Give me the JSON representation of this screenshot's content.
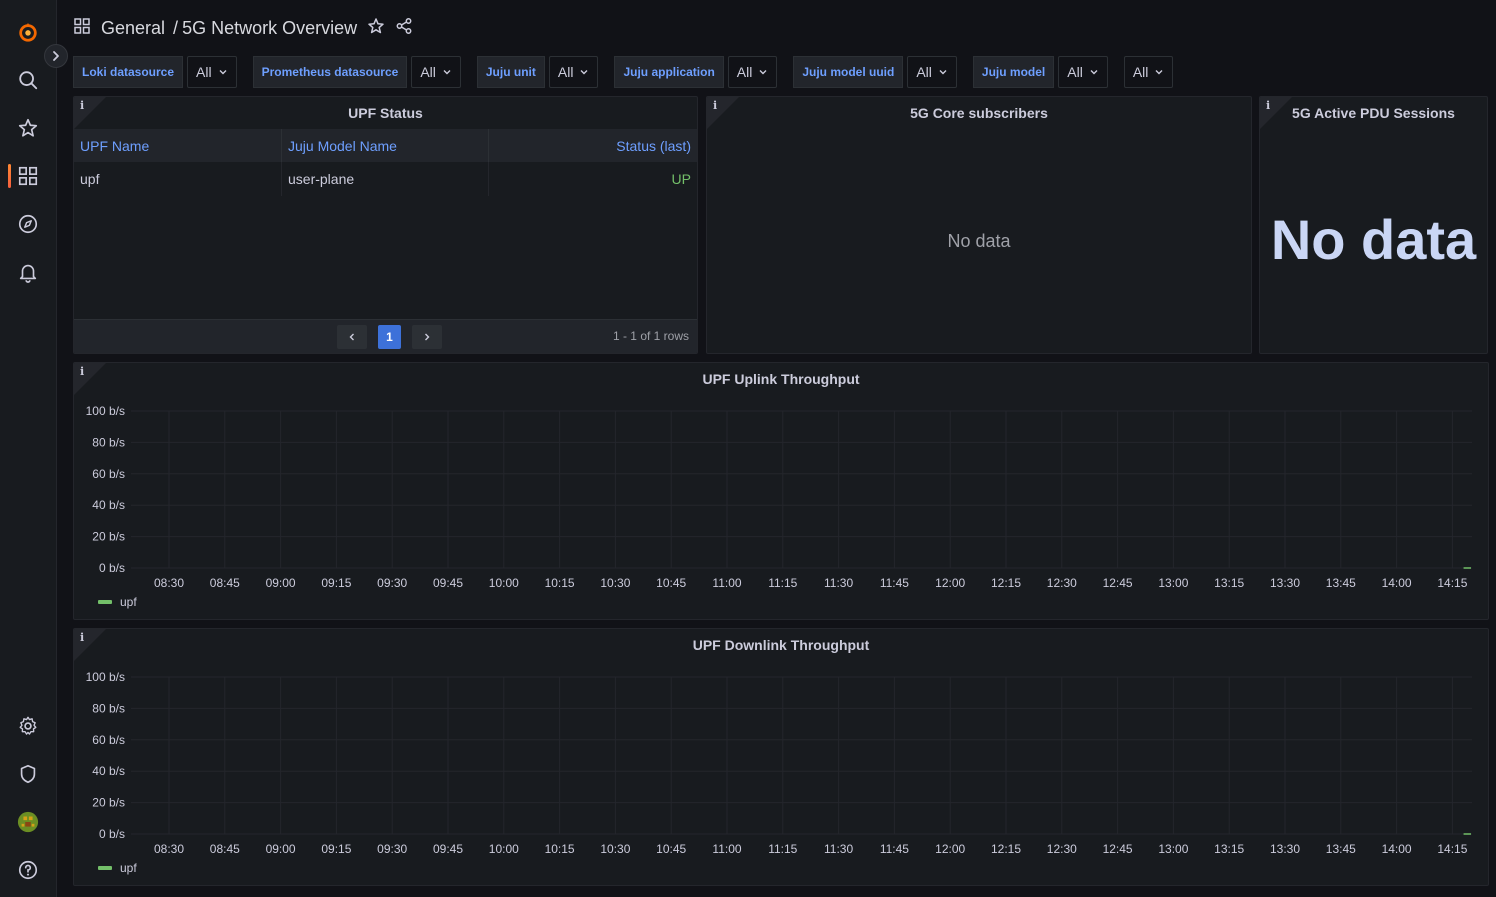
{
  "header": {
    "folder": "General",
    "separator": "/",
    "title": "5G Network Overview"
  },
  "variables": [
    {
      "label": "Loki datasource",
      "value": "All"
    },
    {
      "label": "Prometheus datasource",
      "value": "All"
    },
    {
      "label": "Juju unit",
      "value": "All"
    },
    {
      "label": "Juju application",
      "value": "All"
    },
    {
      "label": "Juju model uuid",
      "value": "All"
    },
    {
      "label": "Juju model",
      "value": "All"
    },
    {
      "label": "",
      "value": "All"
    }
  ],
  "panels": {
    "upf_status": {
      "title": "UPF Status",
      "columns": [
        "UPF Name",
        "Juju Model Name",
        "Status (last)"
      ],
      "rows": [
        [
          "upf",
          "user-plane",
          "UP"
        ]
      ],
      "page": "1",
      "row_info": "1 - 1 of 1 rows"
    },
    "core_subscribers": {
      "title": "5G Core subscribers",
      "message": "No data"
    },
    "pdu_sessions": {
      "title": "5G Active PDU Sessions",
      "message": "No data"
    },
    "info_marker": "i"
  },
  "chart_data": [
    {
      "type": "line",
      "title": "UPF Uplink Throughput",
      "y_ticks": [
        "100 b/s",
        "80 b/s",
        "60 b/s",
        "40 b/s",
        "20 b/s",
        "0 b/s"
      ],
      "ylim": [
        0,
        100
      ],
      "x_ticks": [
        "08:30",
        "08:45",
        "09:00",
        "09:15",
        "09:30",
        "09:45",
        "10:00",
        "10:15",
        "10:30",
        "10:45",
        "11:00",
        "11:15",
        "11:30",
        "11:45",
        "12:00",
        "12:15",
        "12:30",
        "12:45",
        "13:00",
        "13:15",
        "13:30",
        "13:45",
        "14:00",
        "14:15"
      ],
      "series": [
        {
          "name": "upf",
          "color": "#73bf69",
          "x": [
            "14:18",
            "14:20"
          ],
          "values": [
            0,
            0
          ]
        }
      ],
      "grid": true,
      "legend": "bottom-left"
    },
    {
      "type": "line",
      "title": "UPF Downlink Throughput",
      "y_ticks": [
        "100 b/s",
        "80 b/s",
        "60 b/s",
        "40 b/s",
        "20 b/s",
        "0 b/s"
      ],
      "ylim": [
        0,
        100
      ],
      "x_ticks": [
        "08:30",
        "08:45",
        "09:00",
        "09:15",
        "09:30",
        "09:45",
        "10:00",
        "10:15",
        "10:30",
        "10:45",
        "11:00",
        "11:15",
        "11:30",
        "11:45",
        "12:00",
        "12:15",
        "12:30",
        "12:45",
        "13:00",
        "13:15",
        "13:30",
        "13:45",
        "14:00",
        "14:15"
      ],
      "series": [
        {
          "name": "upf",
          "color": "#73bf69",
          "x": [
            "14:18",
            "14:20"
          ],
          "values": [
            0,
            0
          ]
        }
      ],
      "grid": true,
      "legend": "bottom-left"
    }
  ]
}
